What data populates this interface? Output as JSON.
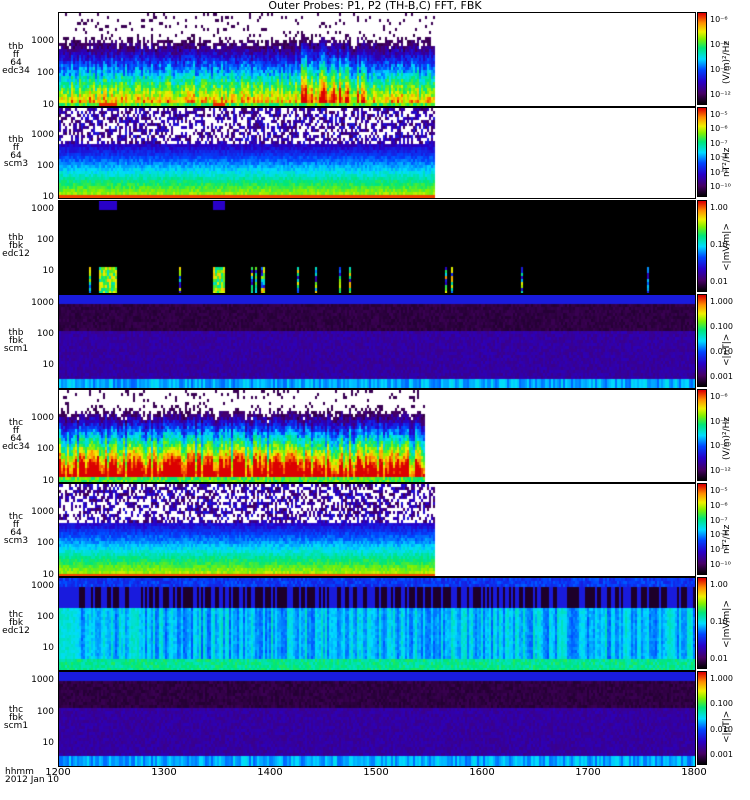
{
  "title": "Outer Probes: P1, P2 (TH-B,C) FFT, FBK",
  "chart_data": {
    "type": "heatmap",
    "title": "Outer Probes: P1, P2 (TH-B,C) FFT, FBK",
    "xlabel": "hhmm",
    "date": "2012 Jan 10",
    "xticks": [
      "1200",
      "1300",
      "1400",
      "1500",
      "1600",
      "1700",
      "1800"
    ],
    "xrange": [
      "12:00",
      "18:00"
    ],
    "panels": [
      {
        "label": [
          "thb",
          "ff",
          "64",
          "edc34"
        ],
        "yticks": [
          "1000",
          "100",
          "10"
        ],
        "unit": "(V/m)²/Hz",
        "cticks": [
          "10⁻⁶",
          "10⁻⁸",
          "10⁻¹⁰",
          "10⁻¹²"
        ],
        "kind": "ffe",
        "data_end_hhmm": "1534"
      },
      {
        "label": [
          "thb",
          "ff",
          "64",
          "scm3"
        ],
        "yticks": [
          "1000",
          "100",
          "10"
        ],
        "unit": "nT²/Hz",
        "cticks": [
          "10⁻⁵",
          "10⁻⁶",
          "10⁻⁷",
          "10⁻⁸",
          "10⁻⁹",
          "10⁻¹⁰"
        ],
        "kind": "ffb",
        "data_end_hhmm": "1534"
      },
      {
        "label": [
          "thb",
          "fbk",
          "edc12"
        ],
        "yticks": [
          "1000",
          "100",
          "10"
        ],
        "unit": "<|mV/m|>",
        "cticks": [
          "1.00",
          "0.10",
          "0.01"
        ],
        "kind": "fbke_b"
      },
      {
        "label": [
          "thb",
          "fbk",
          "scm1"
        ],
        "yticks": [
          "1000",
          "100",
          "10"
        ],
        "unit": "<|nT|>",
        "cticks": [
          "1.000",
          "0.100",
          "0.010",
          "0.001"
        ],
        "kind": "fbkb"
      },
      {
        "label": [
          "thc",
          "ff",
          "64",
          "edc34"
        ],
        "yticks": [
          "1000",
          "100",
          "10"
        ],
        "unit": "(V/m)²/Hz",
        "cticks": [
          "10⁻⁶",
          "10⁻⁸",
          "10⁻¹⁰",
          "10⁻¹²"
        ],
        "kind": "ffe2",
        "data_end_hhmm": "1530"
      },
      {
        "label": [
          "thc",
          "ff",
          "64",
          "scm3"
        ],
        "yticks": [
          "1000",
          "100",
          "10"
        ],
        "unit": "nT²/Hz",
        "cticks": [
          "10⁻⁵",
          "10⁻⁶",
          "10⁻⁷",
          "10⁻⁸",
          "10⁻⁹",
          "10⁻¹⁰"
        ],
        "kind": "ffb",
        "data_end_hhmm": "1530"
      },
      {
        "label": [
          "thc",
          "fbk",
          "edc12"
        ],
        "yticks": [
          "1000",
          "100",
          "10"
        ],
        "unit": "<|mV/m|>",
        "cticks": [
          "1.00",
          "0.10",
          "0.01"
        ],
        "kind": "fbke_c"
      },
      {
        "label": [
          "thc",
          "fbk",
          "scm1"
        ],
        "yticks": [
          "1000",
          "100",
          "10"
        ],
        "unit": "<|nT|>",
        "cticks": [
          "1.000",
          "0.100",
          "0.010",
          "0.001"
        ],
        "kind": "fbkb"
      }
    ]
  }
}
